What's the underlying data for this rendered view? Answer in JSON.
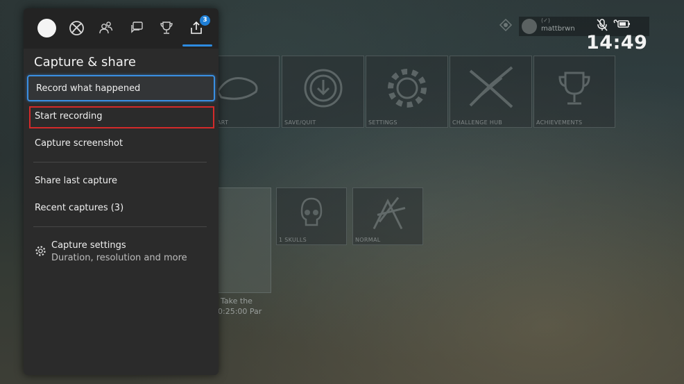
{
  "background": {
    "tiles": [
      {
        "caption": "ART"
      },
      {
        "caption": "SAVE/QUIT"
      },
      {
        "caption": "SETTINGS"
      },
      {
        "caption": "CHALLENGE HUB"
      },
      {
        "caption": "ACHIEVEMENTS"
      }
    ],
    "lower_tiles": [
      {
        "caption": "1 SKULLS",
        "number": "1"
      },
      {
        "caption": "NORMAL"
      }
    ],
    "mission_line1": "Take the",
    "mission_line2": "0:25:00 Par"
  },
  "hud": {
    "gamertag": "mattbrwn",
    "gamerscore_hint": "(✓)",
    "clock": "14:49"
  },
  "guide": {
    "tabs": [
      {
        "name": "profile"
      },
      {
        "name": "xbox-home"
      },
      {
        "name": "people"
      },
      {
        "name": "parties-chats"
      },
      {
        "name": "achievements"
      },
      {
        "name": "capture-share",
        "badge": "3"
      }
    ],
    "title": "Capture & share",
    "items": [
      {
        "label": "Record what happened"
      },
      {
        "label": "Start recording"
      },
      {
        "label": "Capture screenshot"
      },
      {
        "label": "Share last capture"
      },
      {
        "label": "Recent captures (3)"
      }
    ],
    "settings": {
      "label": "Capture settings",
      "sublabel": "Duration, resolution and more"
    }
  },
  "colors": {
    "accent": "#3a8fe2",
    "highlight": "#d42a2a",
    "panel": "#2b2b2b"
  }
}
